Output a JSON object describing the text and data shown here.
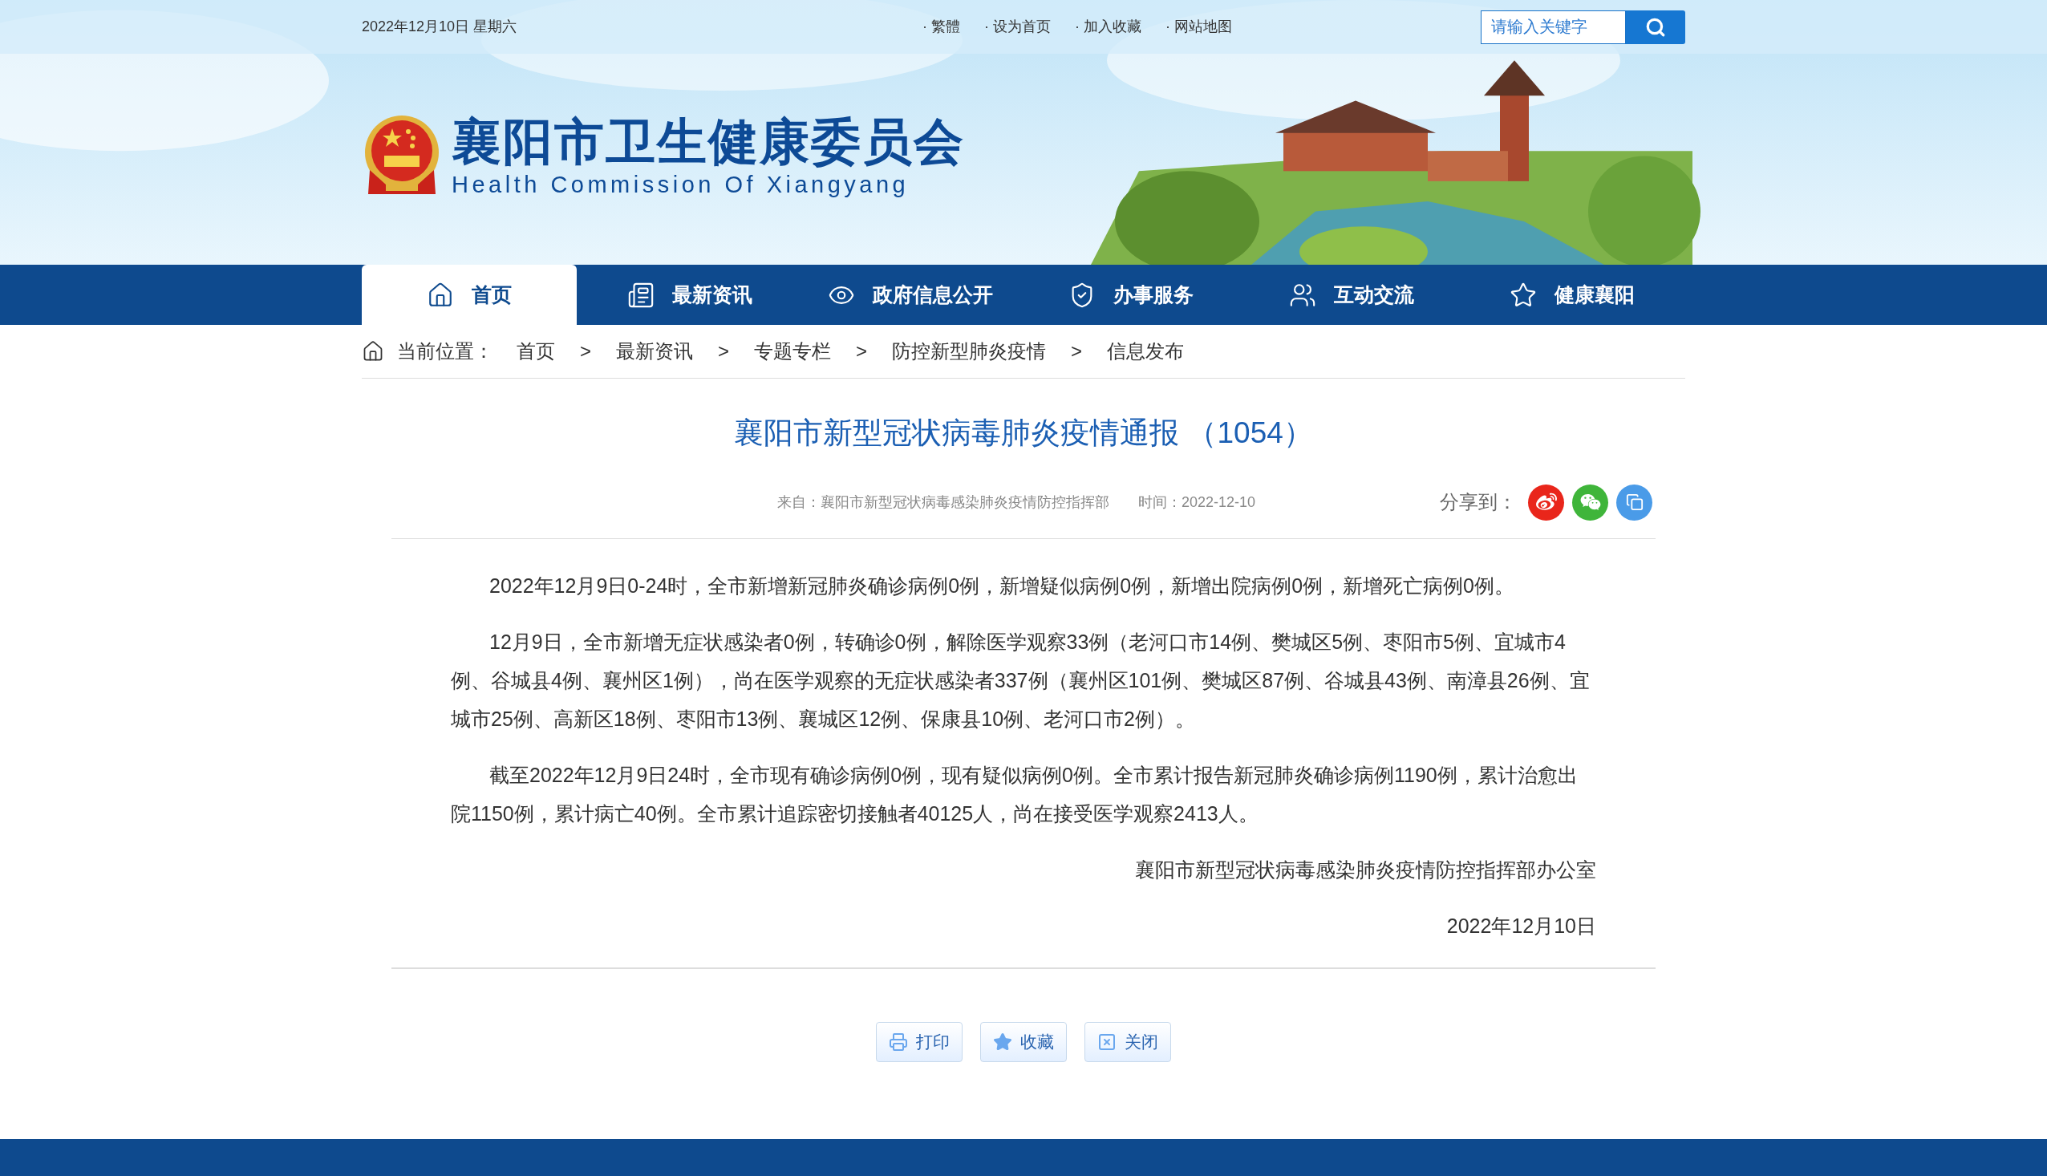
{
  "top_bar": {
    "date": "2022年12月10日 星期六",
    "links": [
      "· 繁體",
      "· 设为首页",
      "· 加入收藏",
      "· 网站地图"
    ],
    "search": {
      "placeholder": "请输入关键字"
    }
  },
  "header": {
    "title": "襄阳市卫生健康委员会",
    "subtitle": "Health Commission Of Xiangyang"
  },
  "nav": [
    {
      "label": "首页",
      "selected": true
    },
    {
      "label": "最新资讯",
      "selected": false
    },
    {
      "label": "政府信息公开",
      "selected": false
    },
    {
      "label": "办事服务",
      "selected": false
    },
    {
      "label": "互动交流",
      "selected": false
    },
    {
      "label": "健康襄阳",
      "selected": false
    }
  ],
  "breadcrumb": {
    "label": "当前位置：",
    "path": [
      "首页",
      ">",
      "最新资讯",
      ">",
      "专题专栏",
      ">",
      "防控新型肺炎疫情",
      ">",
      "信息发布"
    ]
  },
  "article": {
    "title": "襄阳市新型冠状病毒肺炎疫情通报 （1054）",
    "source": "来自：襄阳市新型冠状病毒感染肺炎疫情防控指挥部",
    "time": "时间：2022-12-10",
    "share_label": "分享到：",
    "paragraphs": [
      "2022年12月9日0-24时，全市新增新冠肺炎确诊病例0例，新增疑似病例0例，新增出院病例0例，新增死亡病例0例。",
      "12月9日，全市新增无症状感染者0例，转确诊0例，解除医学观察33例（老河口市14例、樊城区5例、枣阳市5例、宜城市4例、谷城县4例、襄州区1例），尚在医学观察的无症状感染者337例（襄州区101例、樊城区87例、谷城县43例、南漳县26例、宜城市25例、高新区18例、枣阳市13例、襄城区12例、保康县10例、老河口市2例）。",
      "截至2022年12月9日24时，全市现有确诊病例0例，现有疑似病例0例。全市累计报告新冠肺炎确诊病例1190例，累计治愈出院1150例，累计病亡40例。全市累计追踪密切接触者40125人，尚在接受医学观察2413人。"
    ],
    "signature": "襄阳市新型冠状病毒感染肺炎疫情防控指挥部办公室",
    "date": "2022年12月10日"
  },
  "buttons": [
    "打印",
    "收藏",
    "关闭"
  ]
}
